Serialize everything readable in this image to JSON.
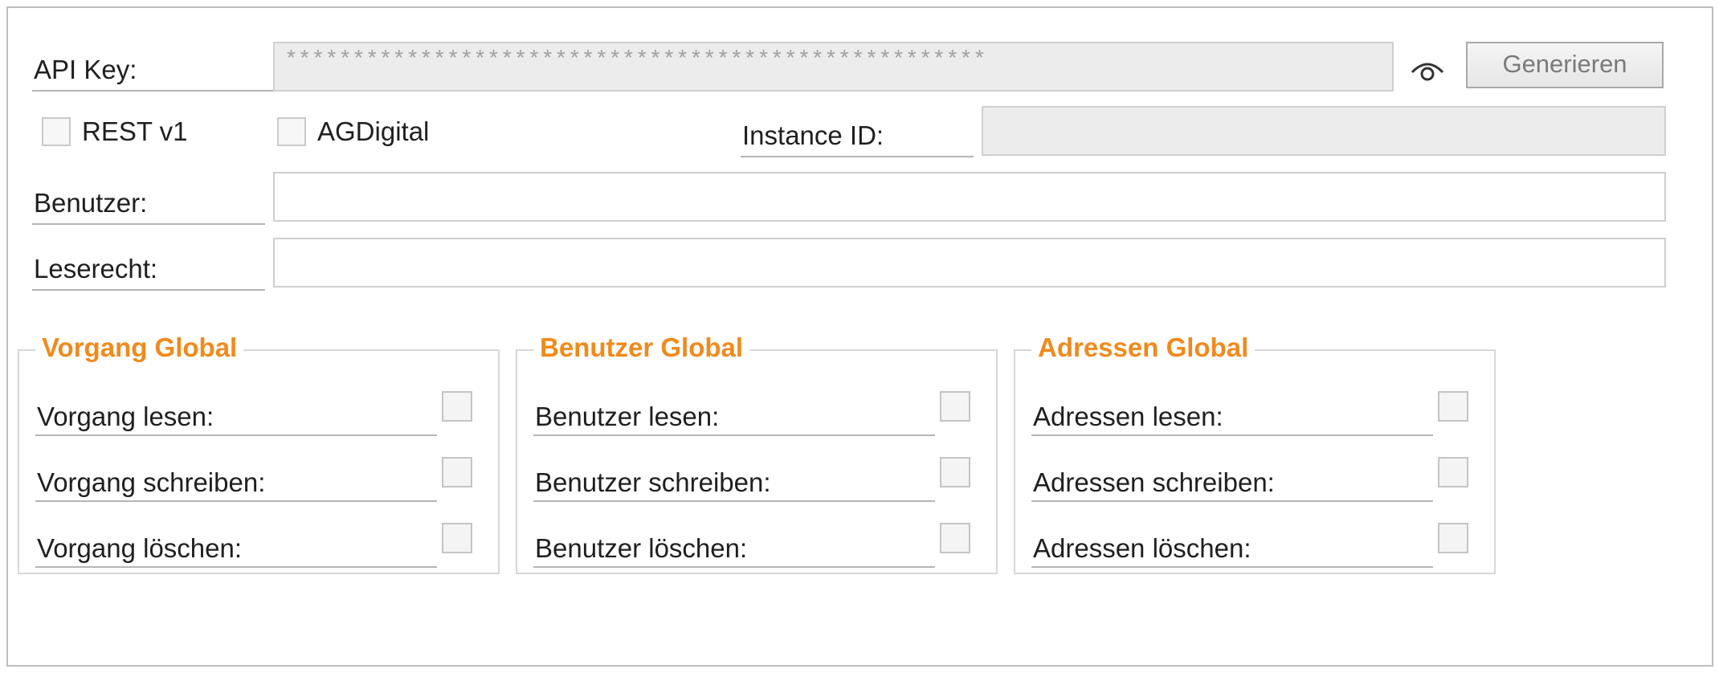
{
  "api_key": {
    "label": "API Key:",
    "value": "****************************************************",
    "reveal_icon": "eye-icon",
    "generate_label": "Generieren"
  },
  "options": {
    "rest_v1_label": "REST v1",
    "agdigital_label": "AGDigital",
    "rest_v1_checked": false,
    "agdigital_checked": false,
    "instance_id_label": "Instance ID:",
    "instance_id_value": ""
  },
  "benutzer": {
    "label": "Benutzer:",
    "value": ""
  },
  "leserecht": {
    "label": "Leserecht:",
    "value": ""
  },
  "colors": {
    "group_title": "#f08a1c",
    "border": "#bfbfbf"
  },
  "groups": [
    {
      "title": "Vorgang Global",
      "items": [
        {
          "label": "Vorgang lesen:",
          "checked": false
        },
        {
          "label": "Vorgang schreiben:",
          "checked": false
        },
        {
          "label": "Vorgang löschen:",
          "checked": false
        }
      ]
    },
    {
      "title": "Benutzer Global",
      "items": [
        {
          "label": "Benutzer lesen:",
          "checked": false
        },
        {
          "label": "Benutzer schreiben:",
          "checked": false
        },
        {
          "label": "Benutzer löschen:",
          "checked": false
        }
      ]
    },
    {
      "title": "Adressen Global",
      "items": [
        {
          "label": "Adressen lesen:",
          "checked": false
        },
        {
          "label": "Adressen schreiben:",
          "checked": false
        },
        {
          "label": "Adressen löschen:",
          "checked": false
        }
      ]
    }
  ]
}
